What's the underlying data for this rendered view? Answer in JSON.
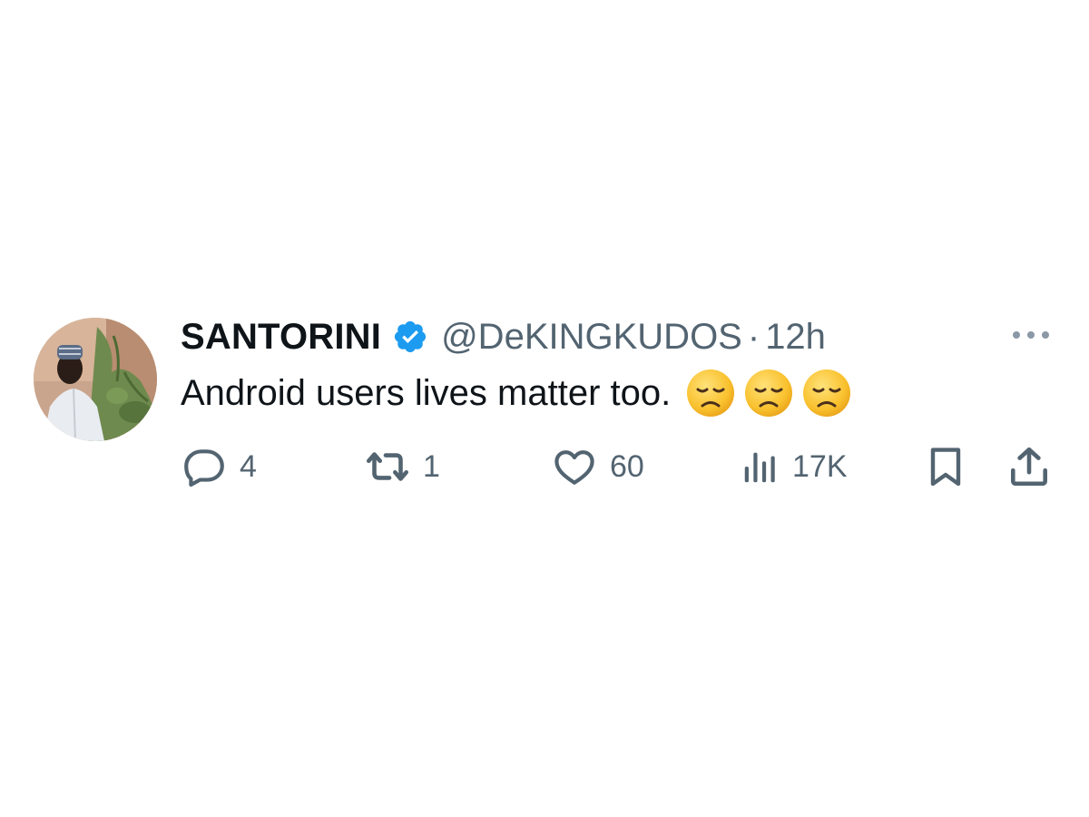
{
  "tweet": {
    "author": {
      "display_name": "SANTORINI",
      "handle": "@DeKINGKUDOS",
      "verified": true
    },
    "separator": "·",
    "time": "12h",
    "text": "Android users lives matter too.",
    "emojis": [
      "disappointed-face-emoji",
      "disappointed-face-emoji",
      "disappointed-face-emoji"
    ],
    "actions": {
      "replies": "4",
      "reposts": "1",
      "likes": "60",
      "views": "17K"
    }
  },
  "colors": {
    "text_primary": "#0f1419",
    "text_secondary": "#536471",
    "verified_blue": "#1d9bf0",
    "background": "#ffffff"
  },
  "icons": {
    "more": "more-dots-icon",
    "reply": "reply-bubble-icon",
    "repost": "repost-arrows-icon",
    "like": "heart-icon",
    "views": "views-bars-icon",
    "bookmark": "bookmark-icon",
    "share": "share-upload-icon",
    "verified": "verified-badge-icon"
  }
}
